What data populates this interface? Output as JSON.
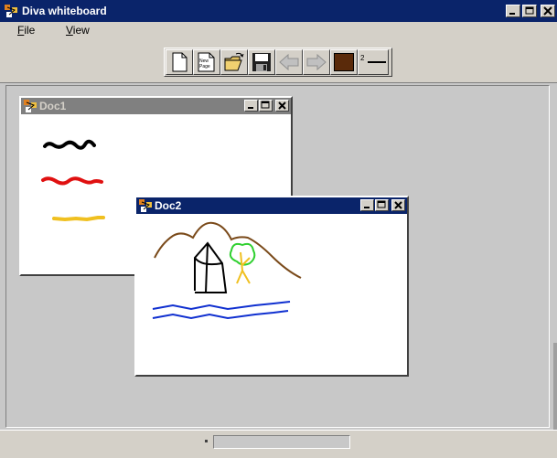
{
  "app": {
    "title": "Diva whiteboard"
  },
  "menu": {
    "items": [
      {
        "label": "File",
        "underline": "F",
        "rest": "ile"
      },
      {
        "label": "View",
        "underline": "V",
        "rest": "iew"
      }
    ]
  },
  "toolbar": {
    "buttons": [
      {
        "name": "new-document-button",
        "icon": "blank-page-icon"
      },
      {
        "name": "new-page-button",
        "icon": "new-page-icon",
        "label": "New Page"
      },
      {
        "name": "open-button",
        "icon": "open-folder-icon"
      },
      {
        "name": "save-button",
        "icon": "floppy-disk-icon"
      },
      {
        "name": "back-button",
        "icon": "arrow-left-icon",
        "disabled": true
      },
      {
        "name": "forward-button",
        "icon": "arrow-right-icon",
        "disabled": true
      }
    ],
    "current_color": "#5a2a0a",
    "stroke_width": "2"
  },
  "documents": [
    {
      "title": "Doc1",
      "state": "inactive",
      "strokes": [
        {
          "color": "#000000"
        },
        {
          "color": "#e01010"
        },
        {
          "color": "#f0c020"
        }
      ]
    },
    {
      "title": "Doc2",
      "state": "active",
      "strokes": [
        {
          "color": "#7a4a1a",
          "depicts": "mountains"
        },
        {
          "color": "#000000",
          "depicts": "house"
        },
        {
          "color": "#30d030",
          "depicts": "tree crown"
        },
        {
          "color": "#f0c020",
          "depicts": "tree trunk"
        },
        {
          "color": "#1030d0",
          "depicts": "river"
        }
      ]
    }
  ],
  "colors": {
    "title_active": "#0a246a",
    "title_inactive": "#808080",
    "face": "#d4d0c8"
  }
}
